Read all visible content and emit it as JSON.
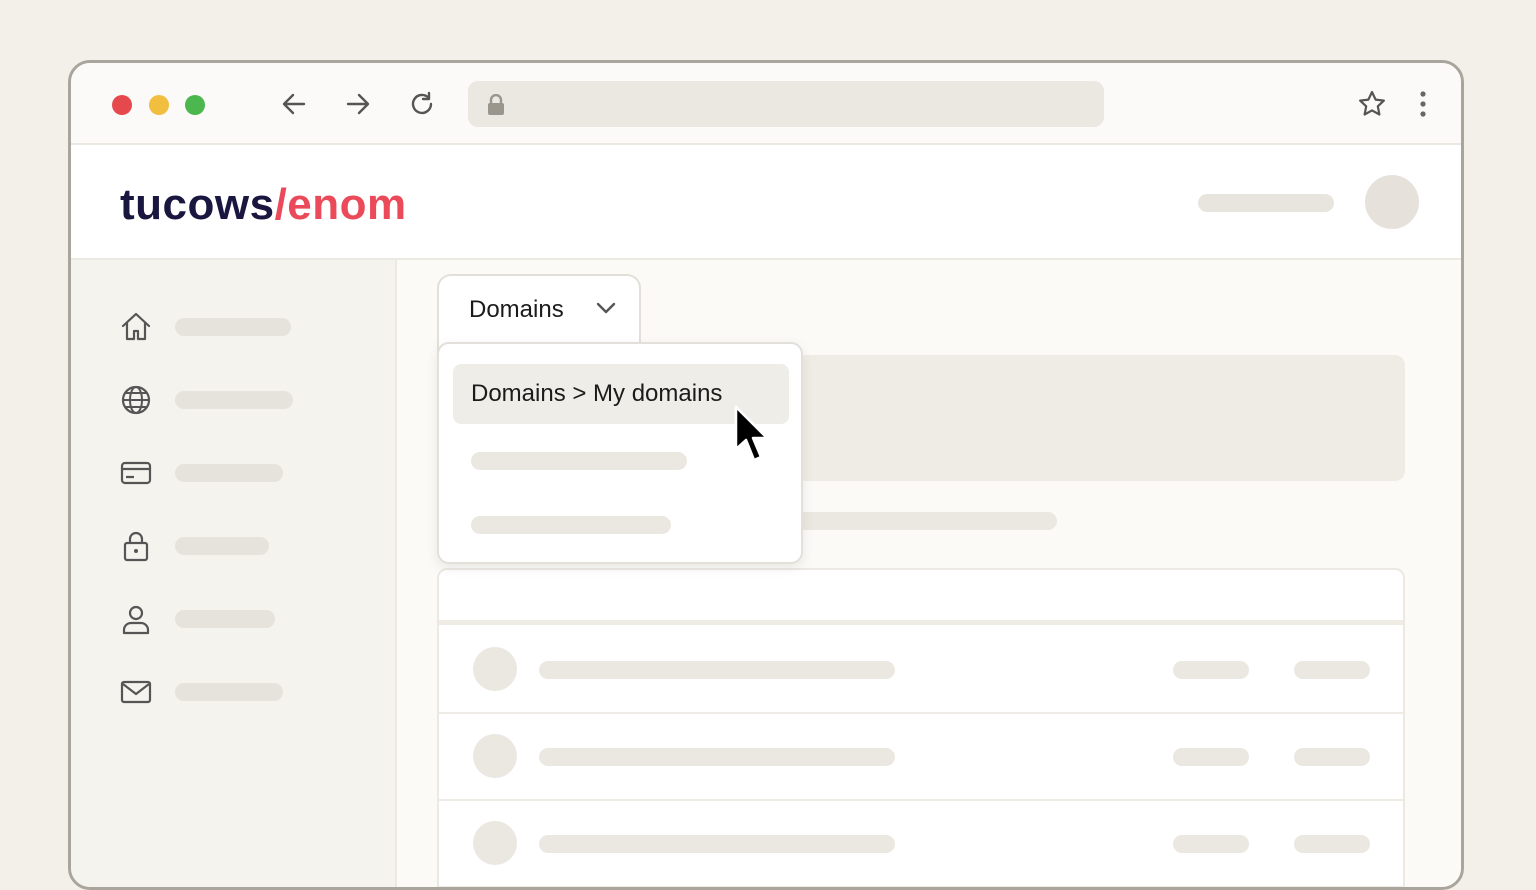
{
  "browser": {
    "address_bar": "",
    "icons": [
      "back-arrow-icon",
      "forward-arrow-icon",
      "reload-icon",
      "lock-icon",
      "star-icon",
      "kebab-menu-icon"
    ]
  },
  "header": {
    "logo_part1": "tucows",
    "logo_part2": "/enom",
    "colors": {
      "logo_dark": "#19163f",
      "logo_accent": "#ea4a5a"
    }
  },
  "sidebar": {
    "items": [
      {
        "icon": "home-icon"
      },
      {
        "icon": "globe-icon"
      },
      {
        "icon": "credit-card-icon"
      },
      {
        "icon": "lock-icon"
      },
      {
        "icon": "user-icon"
      },
      {
        "icon": "mail-icon"
      }
    ]
  },
  "menu": {
    "button_label": "Domains",
    "dropdown_items": [
      {
        "label": "Domains > My domains",
        "highlighted": true
      }
    ]
  }
}
